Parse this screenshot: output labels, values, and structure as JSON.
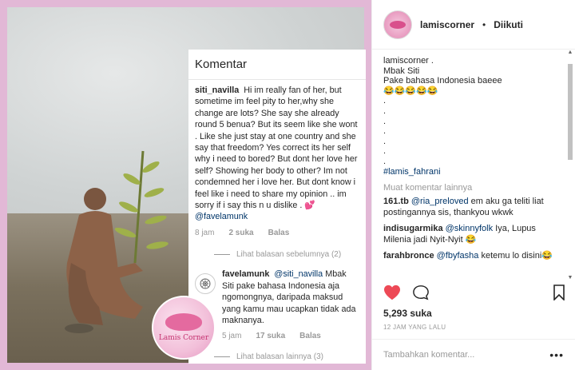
{
  "comments_panel": {
    "title": "Komentar",
    "main": {
      "user": "siti_navilla",
      "text": "Hi im really fan of her, but sometime im feel pity to her,why she change are lots? She say she already round 5 benua? But its seem like she wont . Like she just stay at one country and she say that freedom? Yes correct its her self why i need to bored? But dont her love her self? Showing her body to other? Im not condemned her i love her. But dont know i feel like i need to share my opinion .. im sorry if i say this n u dislike .",
      "emoji": "💕",
      "mention": "@favelamunk",
      "time": "8 jam",
      "likes": "2 suka",
      "reply": "Balas"
    },
    "view_prev": "Lihat balasan sebelumnya (2)",
    "reply_item": {
      "user": "favelamunk",
      "mention": "@siti_navilla",
      "text": "Mbak Siti pake bahasa Indonesia aja ngomongnya, daripada maksud yang kamu mau ucapkan tidak ada maknanya.",
      "time": "5 jam",
      "likes": "17 suka",
      "reply": "Balas"
    },
    "view_more": "Lihat balasan lainnya (3)"
  },
  "badge": {
    "brand": "Lamis Corner"
  },
  "post": {
    "username": "lamiscorner",
    "separator": "•",
    "follow_state": "Diikuti",
    "caption_lines": [
      "lamiscorner .",
      "Mbak Siti",
      "Pake bahasa Indonesia baeee",
      "😂😂😂😂😂",
      ".",
      ".",
      ".",
      ".",
      ".",
      ".",
      "."
    ],
    "hashtag": "#lamis_fahrani",
    "load_more": "Muat komentar lainnya",
    "comments": [
      {
        "user": "161.tb",
        "mention": "@ria_preloved",
        "text": "em aku ga teliti liat postingannya sis, thankyou wkwk"
      },
      {
        "user": "indisugarmika",
        "mention": "@skinnyfolk",
        "text": "Iya, Lupus Milenia jadi Nyit-Nyit 😂"
      },
      {
        "user": "farahbronce",
        "mention": "@fbyfasha",
        "text": "ketemu lo disini😂"
      }
    ],
    "likes": "5,293 suka",
    "timestamp": "12 JAM YANG LALU",
    "add_comment_placeholder": "Tambahkan komentar...",
    "more_dots": "•••"
  },
  "colors": {
    "frame": "#e2b8d6",
    "like_red": "#ed4956",
    "link_blue": "#003569"
  },
  "icons": [
    "heart-icon",
    "comment-icon",
    "bookmark-icon",
    "more-options-icon",
    "spinner-icon"
  ]
}
